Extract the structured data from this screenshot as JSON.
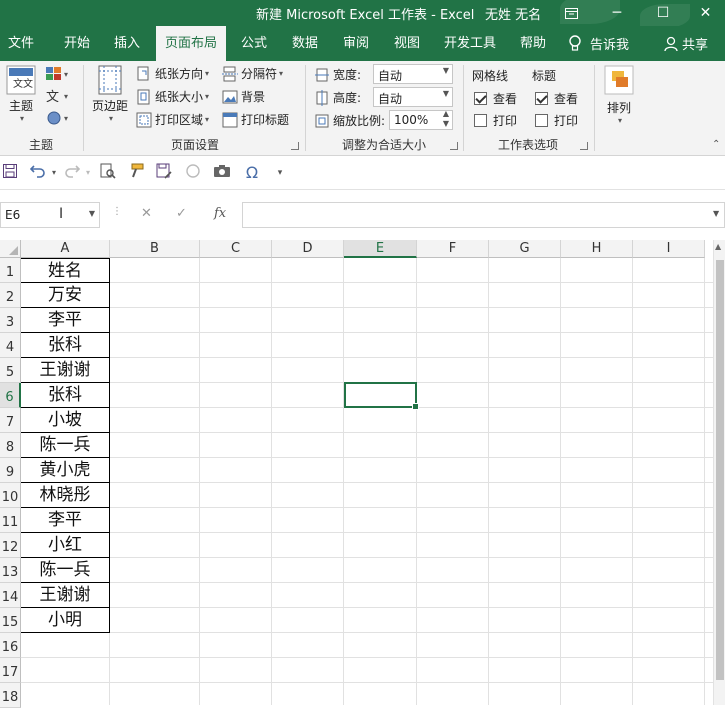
{
  "window": {
    "title": "新建 Microsoft Excel 工作表  -  Excel",
    "user": "无姓 无名",
    "ribbon_display_icon": "ribbon-display-icon",
    "minimize_glyph": "─",
    "maximize_glyph": "☐",
    "close_glyph": "✕"
  },
  "tabs": {
    "items": [
      "文件",
      "开始",
      "插入",
      "页面布局",
      "公式",
      "数据",
      "审阅",
      "视图",
      "开发工具",
      "帮助"
    ],
    "active": "页面布局",
    "tell_me": "告诉我",
    "share": "共享"
  },
  "ribbon": {
    "themes": {
      "theme_label": "主题",
      "group_label": "主题"
    },
    "page_setup": {
      "margins_label": "页边距",
      "orientation_label": "纸张方向",
      "size_label": "纸张大小",
      "print_area_label": "打印区域",
      "breaks_label": "分隔符",
      "background_label": "背景",
      "print_titles_label": "打印标题",
      "group_label": "页面设置"
    },
    "scale_to_fit": {
      "width_label": "宽度:",
      "width_value": "自动",
      "height_label": "高度:",
      "height_value": "自动",
      "scale_label": "缩放比例:",
      "scale_value": "100%",
      "group_label": "调整为合适大小"
    },
    "sheet_options": {
      "gridlines_label": "网格线",
      "headings_label": "标题",
      "view_label": "查看",
      "print_label": "打印",
      "gridlines_view": true,
      "gridlines_print": false,
      "headings_view": true,
      "headings_print": false,
      "group_label": "工作表选项"
    },
    "arrange": {
      "arrange_label": "排列"
    }
  },
  "formula_bar": {
    "name_box": "E6",
    "fx_label": "fx",
    "cancel_glyph": "✕",
    "enter_glyph": "✓",
    "formula": ""
  },
  "sheet": {
    "columns": [
      "A",
      "B",
      "C",
      "D",
      "E",
      "F",
      "G",
      "H",
      "I"
    ],
    "rows": [
      "1",
      "2",
      "3",
      "4",
      "5",
      "6",
      "7",
      "8",
      "9",
      "10",
      "11",
      "12",
      "13",
      "14",
      "15",
      "16",
      "17",
      "18"
    ],
    "selected_cell": "E6",
    "column_a_values": [
      "姓名",
      "万安",
      "李平",
      "张科",
      "王谢谢",
      "张科",
      "小坡",
      "陈一兵",
      "黄小虎",
      "林晓彤",
      "李平",
      "小红",
      "陈一兵",
      "王谢谢",
      "小明"
    ]
  },
  "colors": {
    "accent": "#217346",
    "ribbon_bg": "#f3f3f3",
    "gridline": "#e1e1e1"
  }
}
